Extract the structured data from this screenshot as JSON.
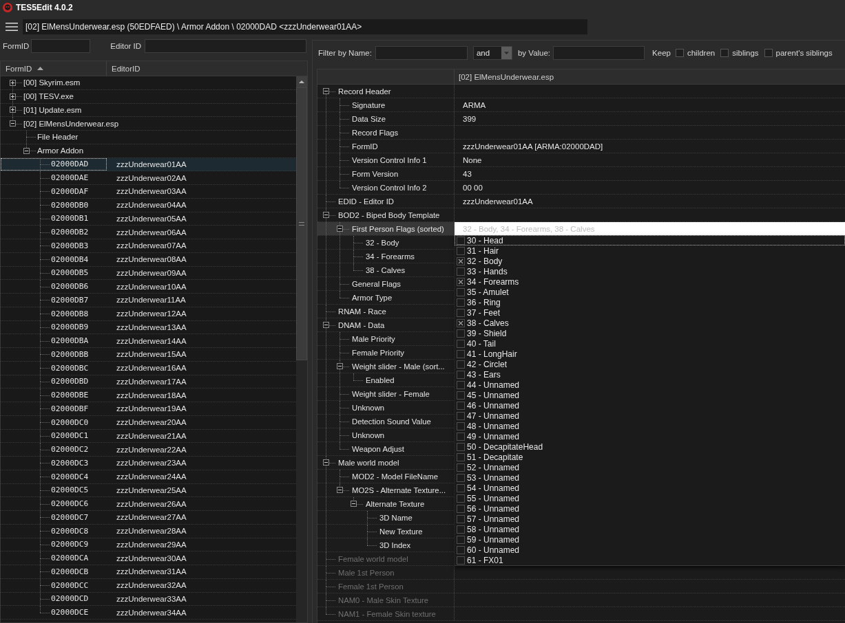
{
  "window": {
    "title": "TES5Edit 4.0.2"
  },
  "path_bar": {
    "value": "[02] ElMensUnderwear.esp (50EDFAED) \\ Armor Addon \\ 02000DAD <zzzUnderwear01AA>"
  },
  "search_fields": [
    {
      "label": "FormID"
    },
    {
      "label": "Editor ID"
    }
  ],
  "navigation": {
    "columns": [
      {
        "label": "FormID",
        "sorted": true
      },
      {
        "label": "EditorID",
        "sorted": false
      }
    ],
    "tree": [
      {
        "label": "[00] Skyrim.esm",
        "expanded": false,
        "selected": false
      },
      {
        "label": "[00] TESV.exe",
        "expanded": false,
        "selected": false
      },
      {
        "label": "[01] Update.esm",
        "expanded": false,
        "selected": false
      },
      {
        "label": "[02] ElMensUnderwear.esp",
        "expanded": true,
        "selected": false,
        "children": [
          {
            "label": "File Header",
            "selected": false
          },
          {
            "label": "Armor Addon",
            "expanded": true,
            "selected": false,
            "children": [
              {
                "form_id": "02000DAD",
                "editor_id": "zzzUnderwear01AA",
                "selected": true
              },
              {
                "form_id": "02000DAE",
                "editor_id": "zzzUnderwear02AA",
                "selected": false
              },
              {
                "form_id": "02000DAF",
                "editor_id": "zzzUnderwear03AA",
                "selected": false
              },
              {
                "form_id": "02000DB0",
                "editor_id": "zzzUnderwear04AA",
                "selected": false
              },
              {
                "form_id": "02000DB1",
                "editor_id": "zzzUnderwear05AA",
                "selected": false
              },
              {
                "form_id": "02000DB2",
                "editor_id": "zzzUnderwear06AA",
                "selected": false
              },
              {
                "form_id": "02000DB3",
                "editor_id": "zzzUnderwear07AA",
                "selected": false
              },
              {
                "form_id": "02000DB4",
                "editor_id": "zzzUnderwear08AA",
                "selected": false
              },
              {
                "form_id": "02000DB5",
                "editor_id": "zzzUnderwear09AA",
                "selected": false
              },
              {
                "form_id": "02000DB6",
                "editor_id": "zzzUnderwear10AA",
                "selected": false
              },
              {
                "form_id": "02000DB7",
                "editor_id": "zzzUnderwear11AA",
                "selected": false
              },
              {
                "form_id": "02000DB8",
                "editor_id": "zzzUnderwear12AA",
                "selected": false
              },
              {
                "form_id": "02000DB9",
                "editor_id": "zzzUnderwear13AA",
                "selected": false
              },
              {
                "form_id": "02000DBA",
                "editor_id": "zzzUnderwear14AA",
                "selected": false
              },
              {
                "form_id": "02000DBB",
                "editor_id": "zzzUnderwear15AA",
                "selected": false
              },
              {
                "form_id": "02000DBC",
                "editor_id": "zzzUnderwear16AA",
                "selected": false
              },
              {
                "form_id": "02000DBD",
                "editor_id": "zzzUnderwear17AA",
                "selected": false
              },
              {
                "form_id": "02000DBE",
                "editor_id": "zzzUnderwear18AA",
                "selected": false
              },
              {
                "form_id": "02000DBF",
                "editor_id": "zzzUnderwear19AA",
                "selected": false
              },
              {
                "form_id": "02000DC0",
                "editor_id": "zzzUnderwear20AA",
                "selected": false
              },
              {
                "form_id": "02000DC1",
                "editor_id": "zzzUnderwear21AA",
                "selected": false
              },
              {
                "form_id": "02000DC2",
                "editor_id": "zzzUnderwear22AA",
                "selected": false
              },
              {
                "form_id": "02000DC3",
                "editor_id": "zzzUnderwear23AA",
                "selected": false
              },
              {
                "form_id": "02000DC4",
                "editor_id": "zzzUnderwear24AA",
                "selected": false
              },
              {
                "form_id": "02000DC5",
                "editor_id": "zzzUnderwear25AA",
                "selected": false
              },
              {
                "form_id": "02000DC6",
                "editor_id": "zzzUnderwear26AA",
                "selected": false
              },
              {
                "form_id": "02000DC7",
                "editor_id": "zzzUnderwear27AA",
                "selected": false
              },
              {
                "form_id": "02000DC8",
                "editor_id": "zzzUnderwear28AA",
                "selected": false
              },
              {
                "form_id": "02000DC9",
                "editor_id": "zzzUnderwear29AA",
                "selected": false
              },
              {
                "form_id": "02000DCA",
                "editor_id": "zzzUnderwear30AA",
                "selected": false
              },
              {
                "form_id": "02000DCB",
                "editor_id": "zzzUnderwear31AA",
                "selected": false
              },
              {
                "form_id": "02000DCC",
                "editor_id": "zzzUnderwear32AA",
                "selected": false
              },
              {
                "form_id": "02000DCD",
                "editor_id": "zzzUnderwear33AA",
                "selected": false
              },
              {
                "form_id": "02000DCE",
                "editor_id": "zzzUnderwear34AA",
                "selected": false
              }
            ]
          }
        ]
      }
    ]
  },
  "filter": {
    "name_label": "Filter by Name:",
    "operator": "and",
    "value_label": "by Value:",
    "keep_label": "Keep",
    "keep_options": [
      {
        "label": "children",
        "checked": false
      },
      {
        "label": "siblings",
        "checked": false
      },
      {
        "label": "parent's siblings",
        "checked": false
      }
    ]
  },
  "record_view": {
    "file_column": "[02] ElMensUnderwear.esp",
    "tree": [
      {
        "label": "Record Header",
        "expanded": true,
        "selected": false,
        "disabled": false,
        "children": [
          {
            "label": "Signature",
            "value": "ARMA",
            "selected": false
          },
          {
            "label": "Data Size",
            "value": "399",
            "selected": false
          },
          {
            "label": "Record Flags",
            "selected": false
          },
          {
            "label": "FormID",
            "value": "zzzUnderwear01AA [ARMA:02000DAD]",
            "selected": false
          },
          {
            "label": "Version Control Info 1",
            "value": "None",
            "selected": false
          },
          {
            "label": "Form Version",
            "value": "43",
            "selected": false
          },
          {
            "label": "Version Control Info 2",
            "value": "00 00",
            "selected": false
          }
        ]
      },
      {
        "label": "EDID - Editor ID",
        "value": "zzzUnderwear01AA",
        "selected": false,
        "disabled": false
      },
      {
        "label": "BOD2 - Biped Body Template",
        "expanded": true,
        "selected": false,
        "disabled": false,
        "children": [
          {
            "label": "First Person Flags (sorted)",
            "expanded": true,
            "selected": true,
            "editor": {
              "value": "32 - Body, 34 - Forearms, 38 - Calves",
              "options": [
                {
                  "label": "30 - Head",
                  "checked": false,
                  "focused": true
                },
                {
                  "label": "31 - Hair",
                  "checked": false,
                  "focused": false
                },
                {
                  "label": "32 - Body",
                  "checked": true,
                  "focused": false
                },
                {
                  "label": "33 - Hands",
                  "checked": false,
                  "focused": false
                },
                {
                  "label": "34 - Forearms",
                  "checked": true,
                  "focused": false
                },
                {
                  "label": "35 - Amulet",
                  "checked": false,
                  "focused": false
                },
                {
                  "label": "36 - Ring",
                  "checked": false,
                  "focused": false
                },
                {
                  "label": "37 - Feet",
                  "checked": false,
                  "focused": false
                },
                {
                  "label": "38 - Calves",
                  "checked": true,
                  "focused": false
                },
                {
                  "label": "39 - Shield",
                  "checked": false,
                  "focused": false
                },
                {
                  "label": "40 - Tail",
                  "checked": false,
                  "focused": false
                },
                {
                  "label": "41 - LongHair",
                  "checked": false,
                  "focused": false
                },
                {
                  "label": "42 - Circlet",
                  "checked": false,
                  "focused": false
                },
                {
                  "label": "43 - Ears",
                  "checked": false,
                  "focused": false
                },
                {
                  "label": "44 - Unnamed",
                  "checked": false,
                  "focused": false
                },
                {
                  "label": "45 - Unnamed",
                  "checked": false,
                  "focused": false
                },
                {
                  "label": "46 - Unnamed",
                  "checked": false,
                  "focused": false
                },
                {
                  "label": "47 - Unnamed",
                  "checked": false,
                  "focused": false
                },
                {
                  "label": "48 - Unnamed",
                  "checked": false,
                  "focused": false
                },
                {
                  "label": "49 - Unnamed",
                  "checked": false,
                  "focused": false
                },
                {
                  "label": "50 - DecapitateHead",
                  "checked": false,
                  "focused": false
                },
                {
                  "label": "51 - Decapitate",
                  "checked": false,
                  "focused": false
                },
                {
                  "label": "52 - Unnamed",
                  "checked": false,
                  "focused": false
                },
                {
                  "label": "53 - Unnamed",
                  "checked": false,
                  "focused": false
                },
                {
                  "label": "54 - Unnamed",
                  "checked": false,
                  "focused": false
                },
                {
                  "label": "55 - Unnamed",
                  "checked": false,
                  "focused": false
                },
                {
                  "label": "56 - Unnamed",
                  "checked": false,
                  "focused": false
                },
                {
                  "label": "57 - Unnamed",
                  "checked": false,
                  "focused": false
                },
                {
                  "label": "58 - Unnamed",
                  "checked": false,
                  "focused": false
                },
                {
                  "label": "59 - Unnamed",
                  "checked": false,
                  "focused": false
                },
                {
                  "label": "60 - Unnamed",
                  "checked": false,
                  "focused": false
                },
                {
                  "label": "61 - FX01",
                  "checked": false,
                  "focused": false
                }
              ]
            },
            "children": [
              {
                "label": "32 - Body",
                "selected": false
              },
              {
                "label": "34 - Forearms",
                "selected": false
              },
              {
                "label": "38 - Calves",
                "selected": false
              }
            ]
          },
          {
            "label": "General Flags",
            "selected": false
          },
          {
            "label": "Armor Type",
            "selected": false
          }
        ]
      },
      {
        "label": "RNAM - Race",
        "selected": false,
        "disabled": false
      },
      {
        "label": "DNAM - Data",
        "expanded": true,
        "selected": false,
        "disabled": false,
        "children": [
          {
            "label": "Male Priority",
            "selected": false
          },
          {
            "label": "Female Priority",
            "selected": false
          },
          {
            "label": "Weight slider - Male (sort...",
            "expanded": true,
            "selected": false,
            "children": [
              {
                "label": "Enabled",
                "selected": false
              }
            ]
          },
          {
            "label": "Weight slider - Female",
            "selected": false
          },
          {
            "label": "Unknown",
            "selected": false
          },
          {
            "label": "Detection Sound Value",
            "selected": false
          },
          {
            "label": "Unknown",
            "selected": false
          },
          {
            "label": "Weapon Adjust",
            "selected": false
          }
        ]
      },
      {
        "label": "Male world model",
        "expanded": true,
        "selected": false,
        "disabled": false,
        "children": [
          {
            "label": "MOD2 - Model FileName",
            "selected": false
          },
          {
            "label": "MO2S - Alternate Texture...",
            "expanded": true,
            "selected": false,
            "children": [
              {
                "label": "Alternate Texture",
                "expanded": true,
                "selected": false,
                "children": [
                  {
                    "label": "3D Name",
                    "selected": false
                  },
                  {
                    "label": "New Texture",
                    "selected": false
                  },
                  {
                    "label": "3D Index",
                    "selected": false
                  }
                ]
              }
            ]
          }
        ]
      },
      {
        "label": "Female world model",
        "selected": false,
        "disabled": true
      },
      {
        "label": "Male 1st Person",
        "selected": false,
        "disabled": true
      },
      {
        "label": "Female 1st Person",
        "selected": false,
        "disabled": true
      },
      {
        "label": "NAM0 - Male Skin Texture",
        "selected": false,
        "disabled": true
      },
      {
        "label": "NAM1 - Female Skin texture",
        "selected": false,
        "disabled": true
      }
    ]
  }
}
